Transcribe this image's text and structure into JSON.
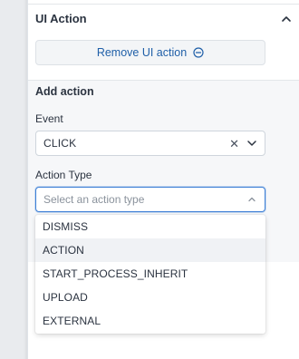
{
  "section": {
    "title": "UI Action",
    "collapse_icon": "chevron-up-icon"
  },
  "remove_button": {
    "label": "Remove UI action",
    "icon": "minus-circle-icon"
  },
  "add_action": {
    "title": "Add action",
    "event": {
      "label": "Event",
      "value": "CLICK",
      "clear_glyph": "✕",
      "icon": "chevron-down-icon"
    },
    "action_type": {
      "label": "Action Type",
      "placeholder": "Select an action type",
      "icon": "chevron-up-icon",
      "options": [
        "DISMISS",
        "ACTION",
        "START_PROCESS_INHERIT",
        "UPLOAD",
        "EXTERNAL"
      ],
      "highlighted": "ACTION"
    }
  },
  "colors": {
    "link": "#1f5fa8",
    "focus_border": "#3d7fd6",
    "hover_option": "#f0f2f5"
  }
}
